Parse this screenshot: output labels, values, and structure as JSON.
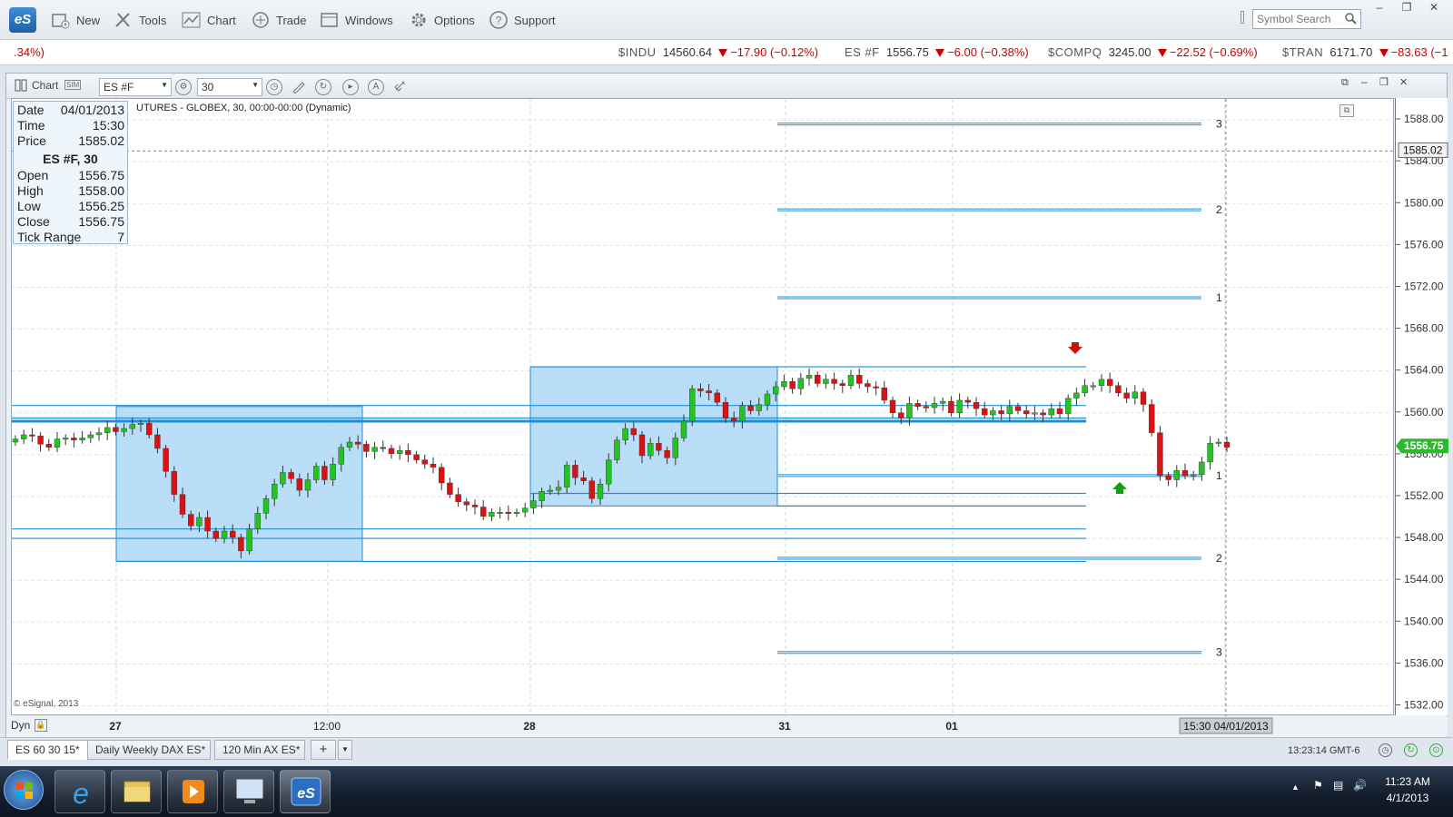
{
  "menubar": {
    "app_logo": "eS",
    "items": [
      {
        "label": "New",
        "icon": "new-chart-icon"
      },
      {
        "label": "Tools",
        "icon": "tools-icon"
      },
      {
        "label": "Chart",
        "icon": "chart-icon"
      },
      {
        "label": "Trade",
        "icon": "trade-icon"
      },
      {
        "label": "Windows",
        "icon": "windows-icon"
      },
      {
        "label": "Options",
        "icon": "gear-icon"
      },
      {
        "label": "Support",
        "icon": "help-icon"
      }
    ],
    "symbol_search_placeholder": "Symbol Search"
  },
  "ticker": {
    "left_fragment": ".34%)",
    "items": [
      {
        "symbol": "$INDU",
        "value": "14560.64",
        "change": "−17.90 (−0.12%)"
      },
      {
        "symbol": "ES #F",
        "value": "1556.75",
        "change": "−6.00 (−0.38%)"
      },
      {
        "symbol": "$COMPQ",
        "value": "3245.00",
        "change": "−22.52 (−0.69%)"
      },
      {
        "symbol": "$TRAN",
        "value": "6171.70",
        "change": "−83.63 (−1"
      }
    ]
  },
  "chart_window": {
    "title": "Chart",
    "symbol": "ES #F",
    "interval": "30",
    "subtitle": "UTURES - GLOBEX, 30, 00:00-00:00 (Dynamic)",
    "copyright": "© eSignal, 2013",
    "dyn_label": "Dyn"
  },
  "info_box": {
    "date_label": "Date",
    "date_value": "04/01/2013",
    "time_label": "Time",
    "time_value": "15:30",
    "price_label": "Price",
    "price_value": "1585.02",
    "title": "ES #F, 30",
    "open_label": "Open",
    "open_value": "1556.75",
    "high_label": "High",
    "high_value": "1558.00",
    "low_label": "Low",
    "low_value": "1556.25",
    "close_label": "Close",
    "close_value": "1556.75",
    "tick_label": "Tick Range",
    "tick_value": "7"
  },
  "chart_data": {
    "type": "candlestick",
    "y_range": [
      1531,
      1590
    ],
    "y_ticks": [
      "1588.00",
      "1584.00",
      "1580.00",
      "1576.00",
      "1572.00",
      "1568.00",
      "1564.00",
      "1560.00",
      "1556.00",
      "1552.00",
      "1548.00",
      "1544.00",
      "1540.00",
      "1536.00",
      "1532.00"
    ],
    "y_tick_values": [
      1588,
      1584,
      1580,
      1576,
      1572,
      1568,
      1564,
      1560,
      1556,
      1552,
      1548,
      1544,
      1540,
      1536,
      1532
    ],
    "x_labels": [
      "27",
      "12:00",
      "28",
      "31",
      "01"
    ],
    "x_cursor_label": "15:30 04/01/2013",
    "crosshair_price": "1585.02",
    "last_price": "1556.75",
    "last_price_color": "#2eb82e",
    "up_color": "#22c322",
    "down_color": "#dd1111",
    "level_color": "#1e8fd6",
    "box_fill": "#b3d9f7",
    "closes": [
      1557.5,
      1557.9,
      1557.8,
      1557.0,
      1556.7,
      1557.5,
      1557.6,
      1557.4,
      1557.6,
      1557.9,
      1558.1,
      1558.6,
      1558.2,
      1558.5,
      1558.9,
      1559.0,
      1557.9,
      1556.6,
      1554.4,
      1552.2,
      1550.3,
      1549.2,
      1550.0,
      1548.7,
      1548.0,
      1548.7,
      1548.1,
      1546.8,
      1548.9,
      1550.4,
      1551.8,
      1553.2,
      1554.3,
      1553.7,
      1552.6,
      1553.6,
      1554.9,
      1553.6,
      1555.1,
      1556.7,
      1557.2,
      1557.0,
      1556.3,
      1556.7,
      1556.6,
      1556.1,
      1556.4,
      1556.0,
      1555.5,
      1555.1,
      1554.8,
      1553.3,
      1552.2,
      1551.5,
      1551.2,
      1551.0,
      1550.1,
      1550.5,
      1550.5,
      1550.4,
      1550.5,
      1550.9,
      1551.6,
      1552.5,
      1552.6,
      1552.9,
      1555.0,
      1553.8,
      1553.5,
      1551.8,
      1553.2,
      1555.5,
      1557.4,
      1558.5,
      1557.9,
      1555.9,
      1557.1,
      1556.4,
      1555.7,
      1557.6,
      1559.2,
      1562.3,
      1562.1,
      1561.9,
      1561.0,
      1559.5,
      1559.2,
      1560.7,
      1560.2,
      1560.8,
      1561.8,
      1562.5,
      1563.0,
      1562.3,
      1563.3,
      1563.6,
      1562.8,
      1563.2,
      1562.8,
      1562.6,
      1563.6,
      1562.8,
      1562.5,
      1562.4,
      1561.2,
      1560.0,
      1559.5,
      1560.9,
      1560.6,
      1560.5,
      1560.9,
      1561.1,
      1560.0,
      1561.2,
      1561.0,
      1560.4,
      1559.8,
      1560.2,
      1559.9,
      1560.6,
      1560.2,
      1559.9,
      1560.0,
      1559.8,
      1560.4,
      1559.9,
      1561.4,
      1561.9,
      1562.6,
      1562.6,
      1563.2,
      1562.6,
      1561.9,
      1561.4,
      1562.0,
      1560.8,
      1558.1,
      1554.0,
      1553.6,
      1554.5,
      1554.0,
      1554.1,
      1555.3,
      1557.1,
      1557.2,
      1556.7
    ],
    "levels": [
      {
        "price": 1587.6,
        "label": "3",
        "start": 0.0,
        "end": 1.0
      },
      {
        "price": 1579.4,
        "label": "2",
        "start": 0.0,
        "end": 1.0
      },
      {
        "price": 1571.0,
        "label": "1",
        "start": 0.0,
        "end": 1.0
      },
      {
        "price": 1554.0,
        "label": "1",
        "start": 0.0,
        "end": 1.0
      },
      {
        "price": 1546.1,
        "label": "2",
        "start": 0.0,
        "end": 1.0
      },
      {
        "price": 1537.1,
        "label": "3",
        "start": 0.0,
        "end": 1.0
      }
    ],
    "range_boxes": [
      {
        "high": 1560.6,
        "low": 1545.8
      },
      {
        "high": 1564.4,
        "low": 1551.1
      }
    ]
  },
  "tabs": [
    {
      "label": "ES 60 30 15*"
    },
    {
      "label": "Daily Weekly DAX ES*"
    },
    {
      "label": "120 Min AX ES*"
    }
  ],
  "status": {
    "time": "13:23:14 GMT-6"
  },
  "taskbar": {
    "clock_time": "11:23 AM",
    "clock_date": "4/1/2013"
  }
}
